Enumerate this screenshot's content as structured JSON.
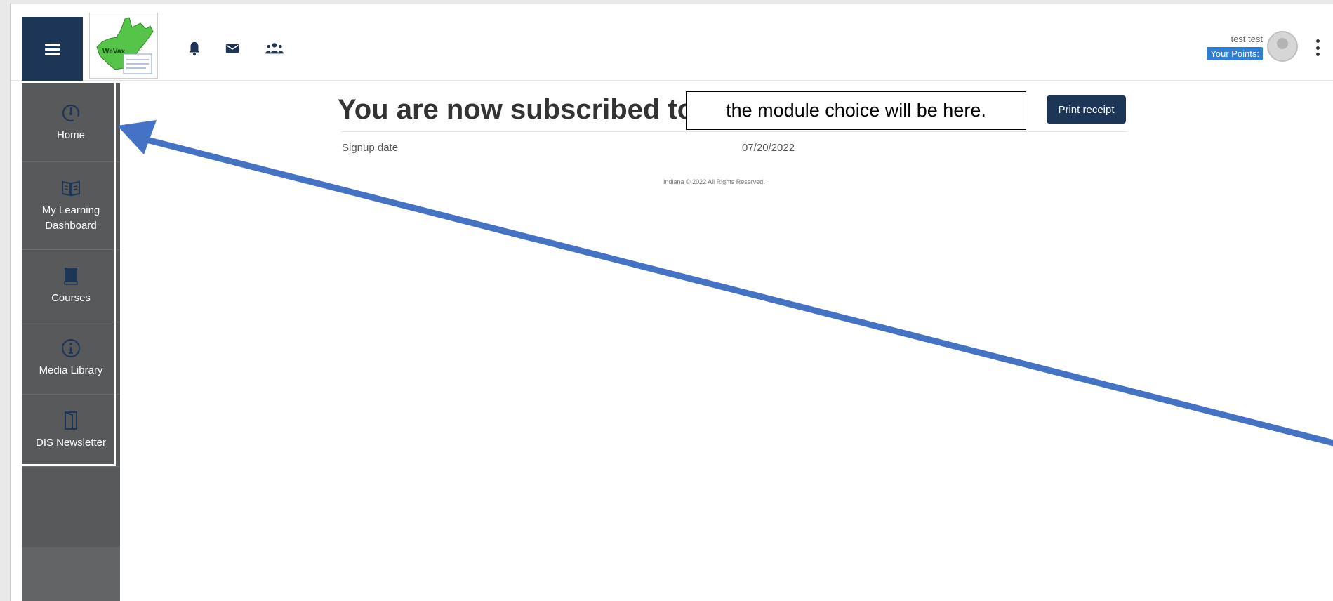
{
  "header": {
    "user_name": "test test",
    "points_label": "Your Points:",
    "logo_text": "WeVax",
    "icons": [
      "menu-icon",
      "bell-icon",
      "envelope-icon",
      "users-icon",
      "more-vertical-icon"
    ]
  },
  "sidebar": {
    "items": [
      {
        "label": "Home",
        "icon": "dashboard-icon"
      },
      {
        "label": "My Learning Dashboard",
        "icon": "open-book-icon"
      },
      {
        "label": "Courses",
        "icon": "book-icon"
      },
      {
        "label": "Media Library",
        "icon": "info-icon"
      },
      {
        "label": "DIS Newsletter",
        "icon": "door-icon"
      }
    ]
  },
  "main": {
    "title": "You are now subscribed to",
    "module_placeholder": "the module choice will be here.",
    "print_button": "Print receipt",
    "signup_label": "Signup date",
    "signup_value": "07/20/2022",
    "footer": "Indiana © 2022 All Rights Reserved."
  },
  "colors": {
    "primary": "#1d3557",
    "sidebar": "#58595b",
    "badge": "#2f7fd4",
    "arrow": "#4472c4"
  }
}
